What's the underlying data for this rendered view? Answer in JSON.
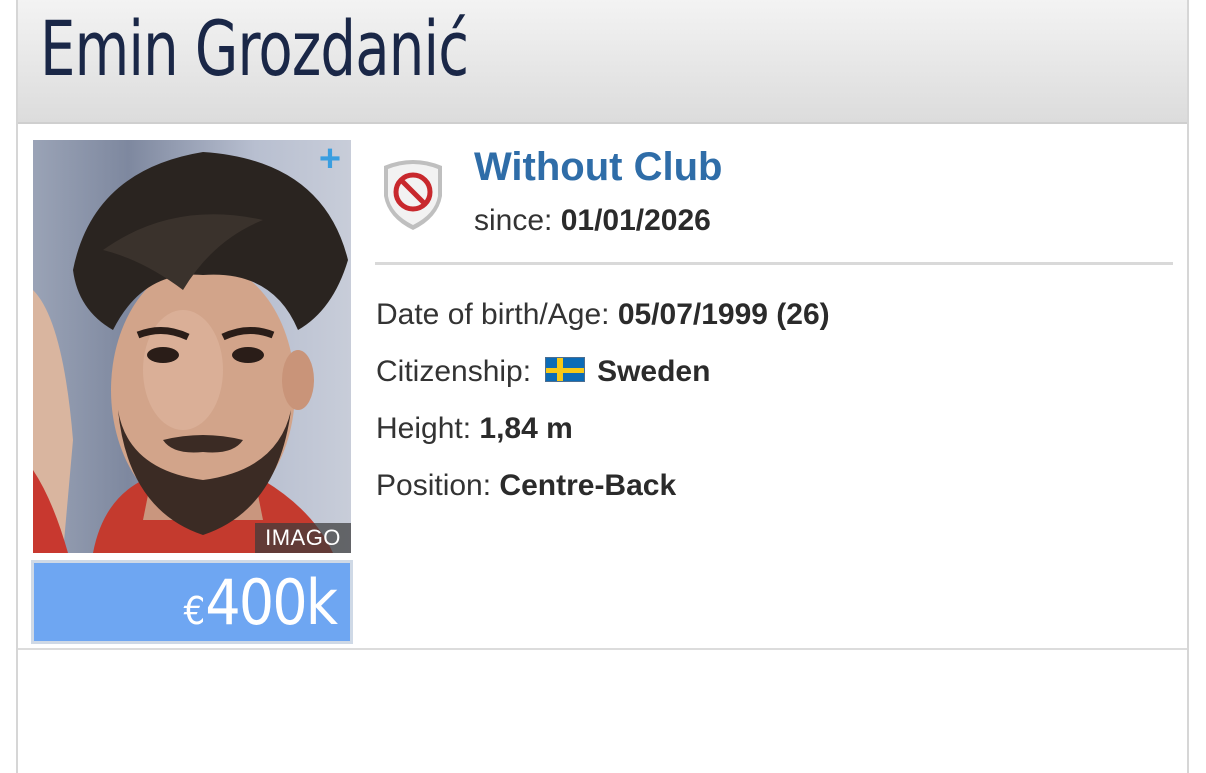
{
  "player": {
    "name": "Emin Grozdanić"
  },
  "photo": {
    "credit": "IMAGO",
    "add_icon": "plus-icon"
  },
  "market_value": {
    "currency": "€",
    "amount": "400k"
  },
  "club": {
    "name": "Without Club",
    "since_label": "since:",
    "since_value": "01/01/2026",
    "badge_icon": "no-club-shield-icon"
  },
  "details": {
    "dob_label": "Date of birth/Age:",
    "dob_value": "05/07/1999 (26)",
    "citizenship_label": "Citizenship:",
    "citizenship_value": "Sweden",
    "citizenship_flag": "sweden-flag-icon",
    "height_label": "Height:",
    "height_value": "1,84 m",
    "position_label": "Position:",
    "position_value": "Centre-Back"
  },
  "colors": {
    "name": "#1a2747",
    "club_link": "#2f6da8",
    "market_value_bg": "#6ea6f2",
    "plus_icon": "#3a9ee0"
  }
}
